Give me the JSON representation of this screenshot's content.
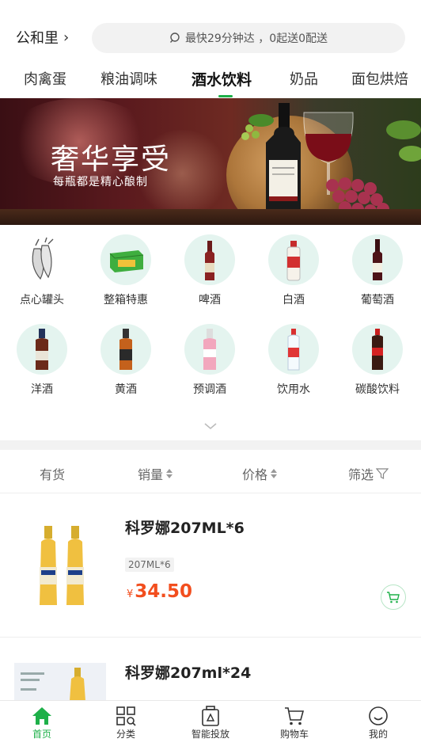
{
  "header": {
    "location": "公和里",
    "search_text": "最快29分钟达 ，0起送0配送"
  },
  "categories": [
    "肉禽蛋",
    "粮油调味",
    "酒水饮料",
    "奶品",
    "面包烘焙"
  ],
  "active_category": "酒水饮料",
  "banner": {
    "title": "奢华享受",
    "subtitle": "每瓶都是精心酿制"
  },
  "subcategories": [
    "点心罐头",
    "整箱特惠",
    "啤酒",
    "白酒",
    "葡萄酒",
    "洋酒",
    "黄酒",
    "预调酒",
    "饮用水",
    "碳酸饮料"
  ],
  "sort": {
    "in_stock": "有货",
    "sales": "销量",
    "price": "价格",
    "filter": "筛选"
  },
  "products": [
    {
      "name": "科罗娜207ML*6",
      "spec": "207ML*6",
      "currency": "¥",
      "price": "34.50"
    },
    {
      "name": "科罗娜207ml*24"
    }
  ],
  "tabbar": {
    "items": [
      {
        "label": "首页",
        "icon": "home-icon"
      },
      {
        "label": "分类",
        "icon": "category-grid-icon"
      },
      {
        "label": "智能投放",
        "icon": "smart-dispatch-icon"
      },
      {
        "label": "购物车",
        "icon": "cart-icon"
      },
      {
        "label": "我的",
        "icon": "profile-icon"
      }
    ],
    "active": "首页"
  },
  "colors": {
    "accent": "#1eb049",
    "price": "#f24e1e",
    "icon_bg": "#e4f4ef"
  }
}
